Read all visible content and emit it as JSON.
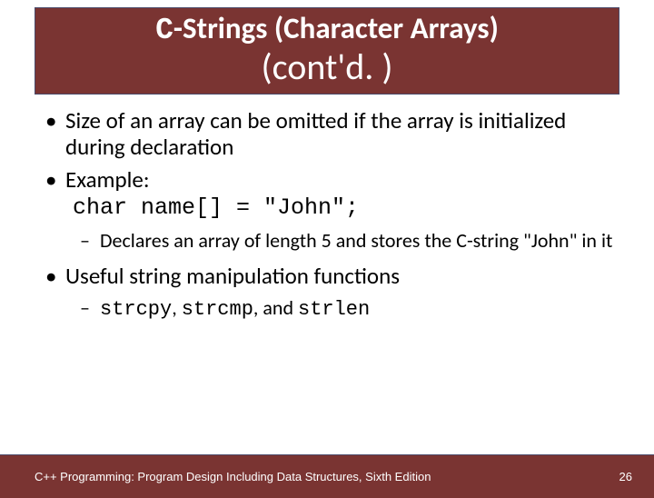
{
  "title": {
    "prefix_mono": "C",
    "rest": "-Strings (Character Arrays)",
    "line2": "(cont'd. )"
  },
  "bullets": {
    "b1": "Size of an array can be omitted if the array is initialized during declaration",
    "b2_label": "Example:",
    "b2_code": "char name[] = \"John\";",
    "b2_sub1": "Declares an array of length 5 and stores  the C-string \"John\" in it",
    "b3": "Useful string manipulation functions",
    "b3_sub_prefix": "",
    "b3_fn1": "strcpy",
    "b3_sep1": ", ",
    "b3_fn2": "strcmp",
    "b3_sep2": ", and ",
    "b3_fn3": "strlen"
  },
  "footer": {
    "left": "C++ Programming: Program Design Including Data Structures, Sixth Edition",
    "page": "26"
  }
}
